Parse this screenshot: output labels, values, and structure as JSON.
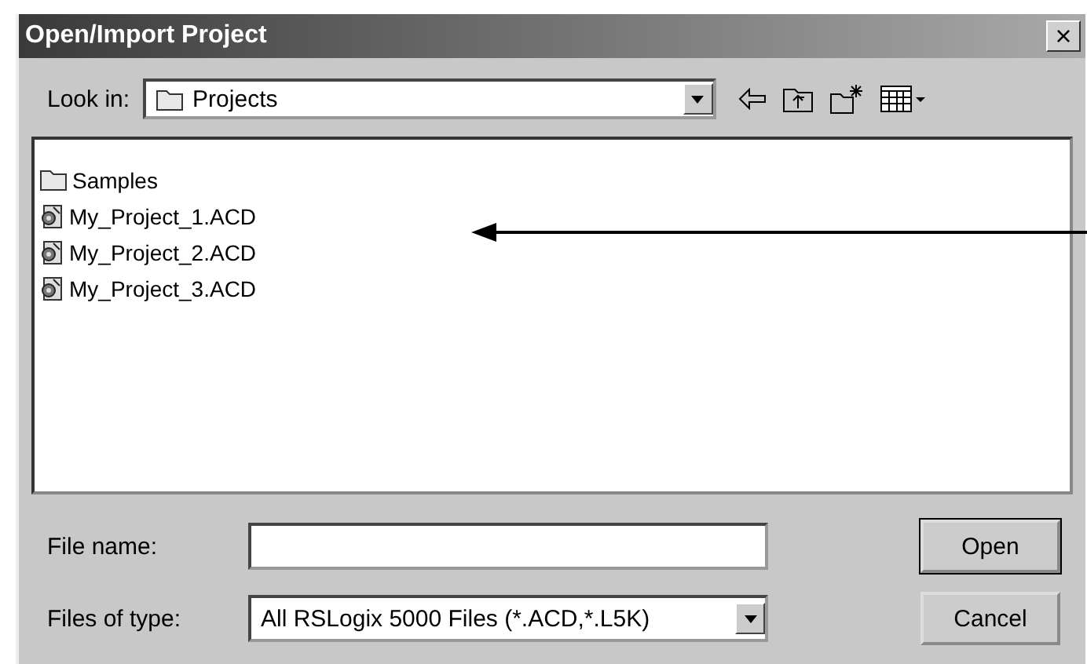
{
  "window": {
    "title": "Open/Import Project",
    "close": "×"
  },
  "look_in": {
    "label": "Look in:",
    "value": "Projects"
  },
  "files": [
    {
      "name": "Samples",
      "kind": "folder"
    },
    {
      "name": "My_Project_1.ACD",
      "kind": "project"
    },
    {
      "name": "My_Project_2.ACD",
      "kind": "project"
    },
    {
      "name": "My_Project_3.ACD",
      "kind": "project"
    }
  ],
  "file_name": {
    "label": "File name:"
  },
  "files_of_type": {
    "label": "Files of type:",
    "value": "All RSLogix 5000 Files (*.ACD,*.L5K)"
  },
  "buttons": [
    {
      "label": "Open",
      "default": true
    },
    {
      "label": "Cancel",
      "default": false
    }
  ]
}
